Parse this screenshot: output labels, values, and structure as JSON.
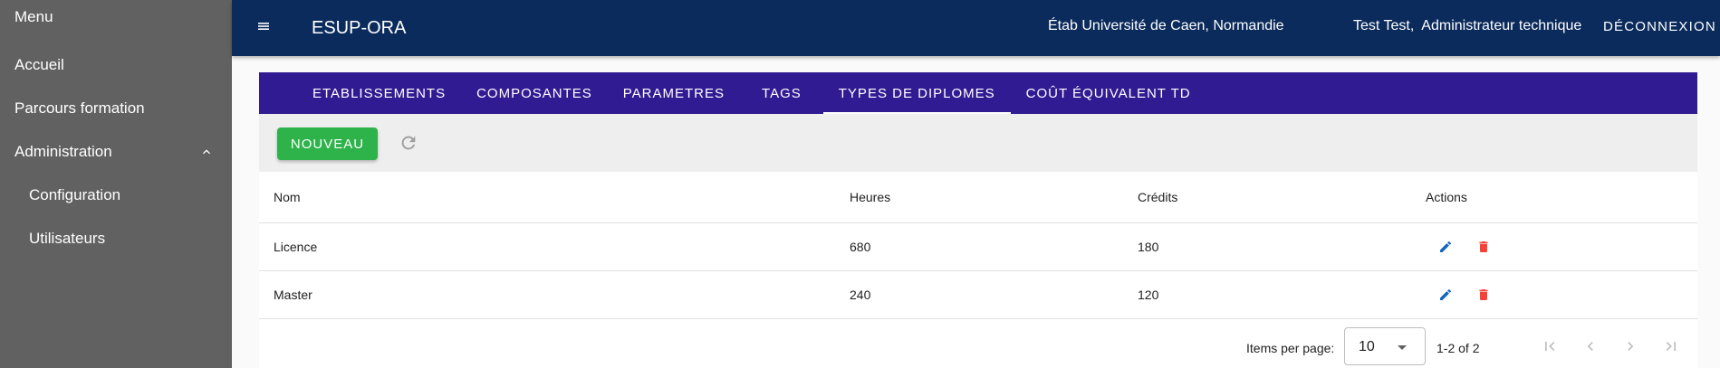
{
  "sidebar": {
    "menu_title": "Menu",
    "items": [
      {
        "label": "Accueil"
      },
      {
        "label": "Parcours formation"
      },
      {
        "label": "Administration"
      },
      {
        "label": "Configuration"
      },
      {
        "label": "Utilisateurs"
      }
    ]
  },
  "header": {
    "app_title": "ESUP-ORA",
    "etablissement": "Étab Université de Caen, Normandie",
    "user": "Test Test,  Administrateur technique",
    "logout_label": "DÉCONNEXION"
  },
  "tabs": [
    {
      "label": "ETABLISSEMENTS"
    },
    {
      "label": "COMPOSANTES"
    },
    {
      "label": "PARAMETRES"
    },
    {
      "label": "TAGS"
    },
    {
      "label": "TYPES DE DIPLOMES"
    },
    {
      "label": "COÛT ÉQUIVALENT TD"
    }
  ],
  "active_tab": "TYPES DE DIPLOMES",
  "toolbar": {
    "new_label": "NOUVEAU"
  },
  "table": {
    "headers": [
      "Nom",
      "Heures",
      "Crédits",
      "Actions"
    ],
    "rows": [
      {
        "nom": "Licence",
        "heures": "680",
        "credits": "180"
      },
      {
        "nom": "Master",
        "heures": "240",
        "credits": "120"
      }
    ]
  },
  "paginator": {
    "items_per_page_label": "Items per page:",
    "page_size": "10",
    "range_label": "1-2 of 2"
  },
  "colors": {
    "topbar": "#0b2b5c",
    "tabs": "#311b92",
    "sidebar": "#616161",
    "new_button": "#2db34a",
    "edit_icon": "#1565c0",
    "delete_icon": "#f44336"
  }
}
